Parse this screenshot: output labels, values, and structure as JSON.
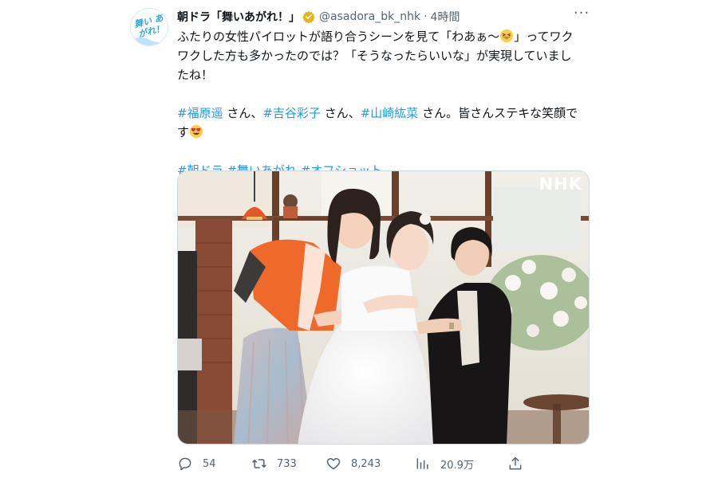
{
  "account": {
    "display_name": "朝ドラ「舞いあがれ！」",
    "handle": "@asadora_bk_nhk",
    "separator": "·",
    "time": "4時間",
    "avatar_logo": "舞い あがれ！"
  },
  "tweet": {
    "line1": "ふたりの女性パイロットが語り合うシーンを見て「わあぁ〜",
    "line1_end": "」ってワク",
    "line2": "ワクした方も多かったのでは？「そうなったらいいな」が実現していまし",
    "line3": "たね！",
    "tags_row": [
      {
        "tag": "#福原遥",
        "suffix": " さん、"
      },
      {
        "tag": "#吉谷彩子",
        "suffix": " さん、"
      },
      {
        "tag": "#山崎紘菜",
        "suffix": " さん。皆さんステキな笑顔で"
      }
    ],
    "line5": "す",
    "hashtags": [
      "#朝ドラ",
      "#舞いあがれ",
      "#オフショット"
    ],
    "emoji_grin": "grinning-squint-emoji",
    "emoji_hearts": "heart-eyes-emoji"
  },
  "media": {
    "watermark": "NHK"
  },
  "actions": {
    "replies": "54",
    "retweets": "733",
    "likes": "8,243",
    "views": "20.9万",
    "icons": [
      "reply-icon",
      "retweet-icon",
      "like-icon",
      "views-icon",
      "share-icon"
    ]
  },
  "colors": {
    "link": "#1d9bf0",
    "muted": "#536471",
    "text": "#0f1419",
    "verified": "#e2b719"
  }
}
